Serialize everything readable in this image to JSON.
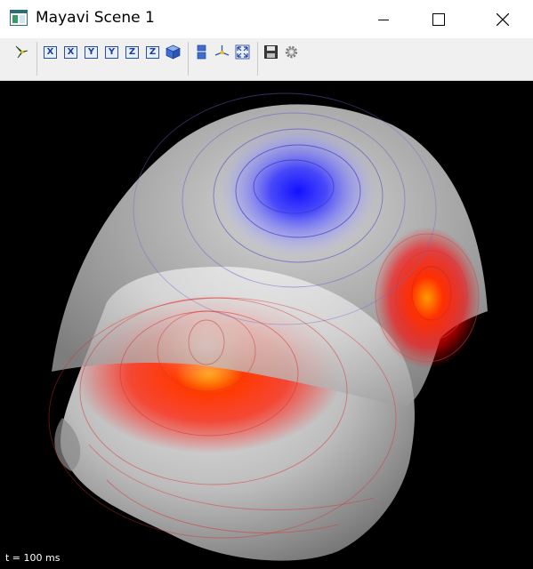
{
  "window": {
    "title": "Mayavi Scene 1",
    "controls": [
      "minimize-icon",
      "maximize-icon",
      "close-icon"
    ]
  },
  "toolbar": {
    "groups": [
      [
        "mayavi-pipeline-icon"
      ],
      [
        "view-x-plus",
        "view-x-minus",
        "view-y-plus",
        "view-y-minus",
        "view-z-plus",
        "view-z-minus",
        "isometric-view"
      ],
      [
        "parallel-projection",
        "axes-indicator",
        "full-screen"
      ],
      [
        "save-icon",
        "settings-icon"
      ]
    ],
    "axis_labels": [
      "X",
      "X",
      "Y",
      "Y",
      "Z",
      "Z"
    ]
  },
  "scene": {
    "time_label": "t = 100 ms",
    "colors": {
      "background": "#000000",
      "positive": "#ff2a00",
      "negative": "#2a2aff",
      "surface": "#a6a6a6"
    }
  }
}
